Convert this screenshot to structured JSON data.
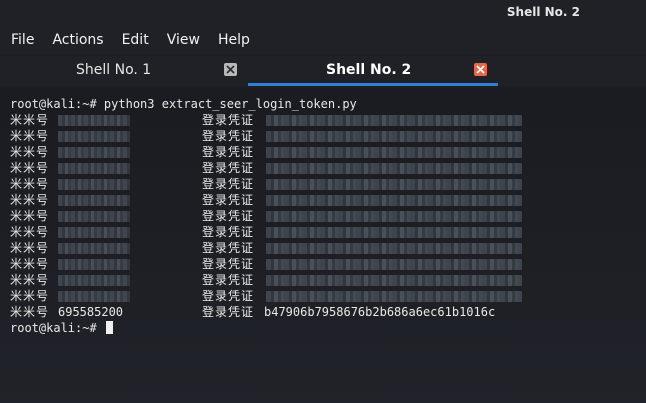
{
  "window": {
    "title": "Shell No. 2"
  },
  "menu": {
    "items": [
      "File",
      "Actions",
      "Edit",
      "View",
      "Help"
    ]
  },
  "tabs": [
    {
      "label": "Shell No. 1",
      "active": false
    },
    {
      "label": "Shell No. 2",
      "active": true
    }
  ],
  "colors": {
    "accent": "#2f7fd6",
    "active_close": "#e06a4e",
    "inactive_close": "#b8b8b8",
    "background": "#1c1e23"
  },
  "terminal": {
    "command_line": "root@kali:~# python3 extract_seer_login_token.py",
    "id_label": "米米号",
    "credential_label": "登录凭证",
    "rows": [
      {
        "id": "",
        "token": "",
        "redacted": true
      },
      {
        "id": "",
        "token": "",
        "redacted": true
      },
      {
        "id": "",
        "token": "",
        "redacted": true
      },
      {
        "id": "",
        "token": "",
        "redacted": true
      },
      {
        "id": "",
        "token": "",
        "redacted": true
      },
      {
        "id": "",
        "token": "",
        "redacted": true
      },
      {
        "id": "",
        "token": "",
        "redacted": true
      },
      {
        "id": "",
        "token": "",
        "redacted": true
      },
      {
        "id": "",
        "token": "",
        "redacted": true
      },
      {
        "id": "",
        "token": "",
        "redacted": true
      },
      {
        "id": "",
        "token": "",
        "redacted": true
      },
      {
        "id": "",
        "token": "",
        "redacted": true
      },
      {
        "id": "695585200",
        "token": "b47906b7958676b2b686a6ec61b1016c",
        "redacted": false
      }
    ],
    "prompt": "root@kali:~# "
  }
}
